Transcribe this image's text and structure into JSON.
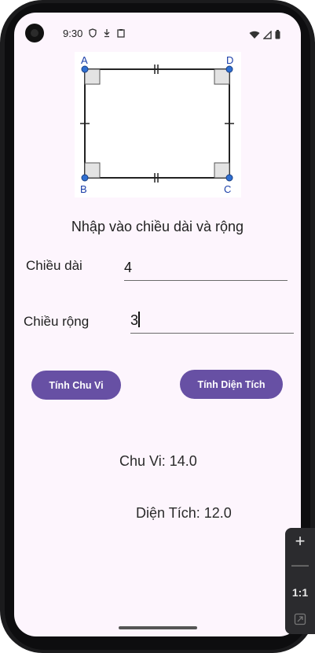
{
  "status_bar": {
    "time": "9:30"
  },
  "figure": {
    "vertex_labels": [
      "A",
      "D",
      "B",
      "C"
    ]
  },
  "main": {
    "prompt": "Nhập vào chiều dài và rộng",
    "length_label": "Chiều dài",
    "length_value": "4",
    "width_label": "Chiều rộng",
    "width_value": "3",
    "perimeter_button": "Tính Chu Vi",
    "area_button": "Tính Diện Tích",
    "perimeter_result": "Chu Vi: 14.0",
    "area_result": "Diện Tích: 12.0"
  },
  "zoom_controls": {
    "zoom_in": "+",
    "zoom_out": "—",
    "ratio": "1:1"
  },
  "colors": {
    "accent": "#6750a4",
    "background": "#fdf5fd",
    "vertex_dot": "#2f6fd1"
  },
  "icons": [
    "wifi-icon",
    "signal-icon",
    "battery-icon",
    "shield-icon",
    "download-icon",
    "clipboard-icon"
  ]
}
